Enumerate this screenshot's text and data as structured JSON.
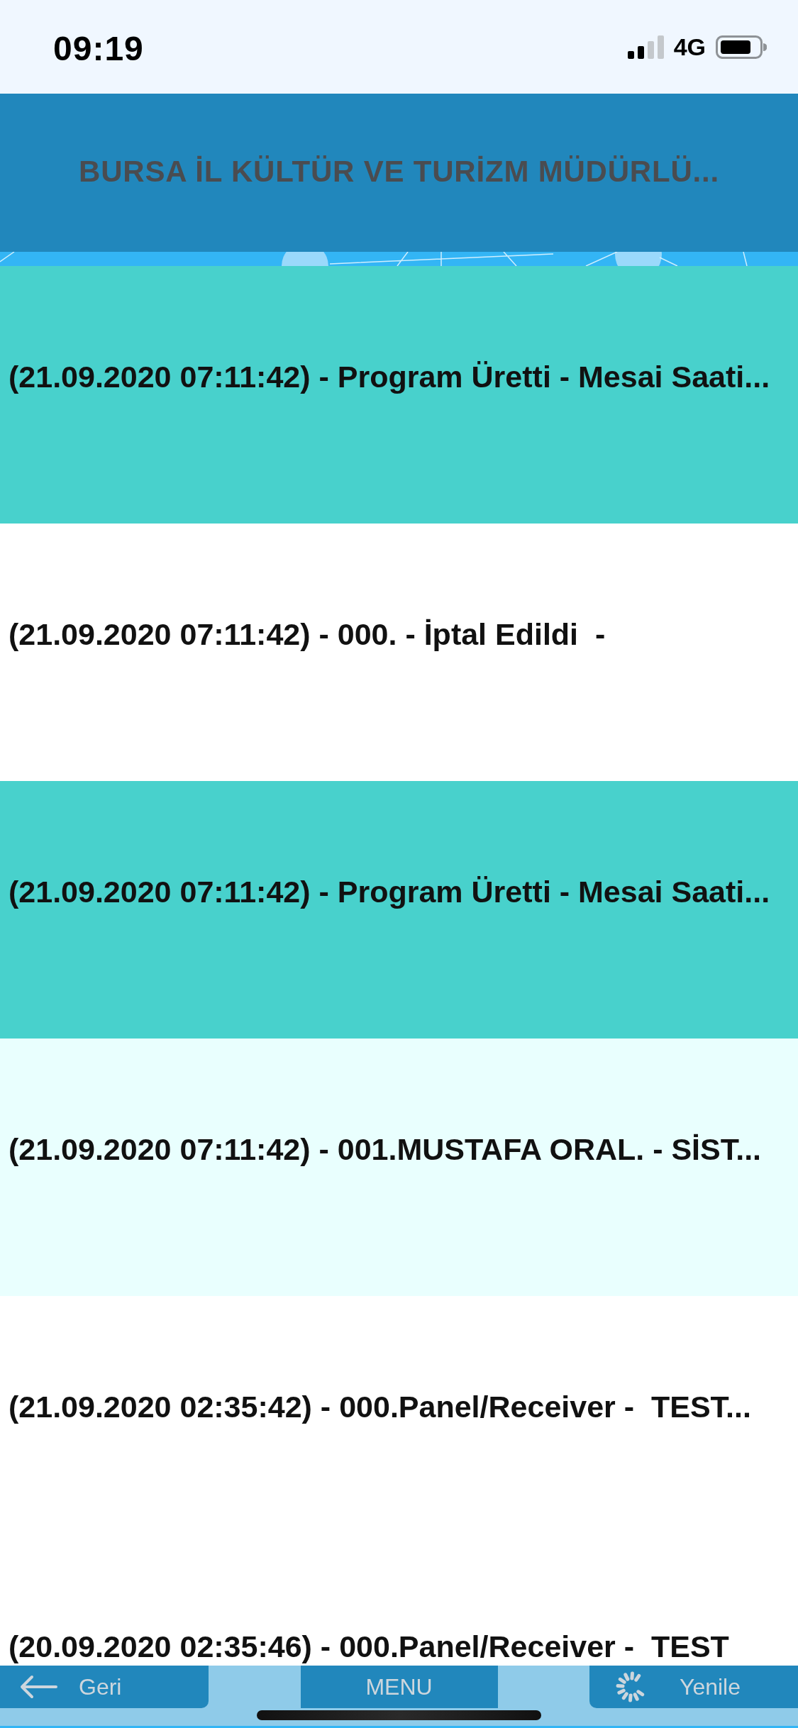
{
  "status_bar": {
    "time": "09:19",
    "network": "4G"
  },
  "header": {
    "title": "BURSA İL KÜLTÜR VE TURİZM MÜDÜRLÜ..."
  },
  "log_rows": [
    {
      "text": "(21.09.2020 07:11:42) - Program Üretti - Mesai Saati...",
      "color": "#48d1cc"
    },
    {
      "text": "(21.09.2020 07:11:42) - 000. - İptal Edildi  -",
      "color": "#ffffff"
    },
    {
      "text": "(21.09.2020 07:11:42) - Program Üretti - Mesai Saati...",
      "color": "#48d1cc"
    },
    {
      "text": "(21.09.2020 07:11:42) - 001.MUSTAFA ORAL. - SİST...",
      "color": "#e9fffe"
    },
    {
      "text": "(21.09.2020 02:35:42) - 000.Panel/Receiver -  TEST...",
      "color": "#ffffff"
    },
    {
      "text": "(20.09.2020 02:35:46) - 000.Panel/Receiver -  TEST",
      "color": "#ffffff"
    }
  ],
  "bottom_bar": {
    "buttons": [
      {
        "label": "Geri",
        "kind": "back"
      },
      {
        "label": "MENU",
        "kind": "menu"
      },
      {
        "label": "Yenile",
        "kind": "refresh"
      }
    ]
  }
}
